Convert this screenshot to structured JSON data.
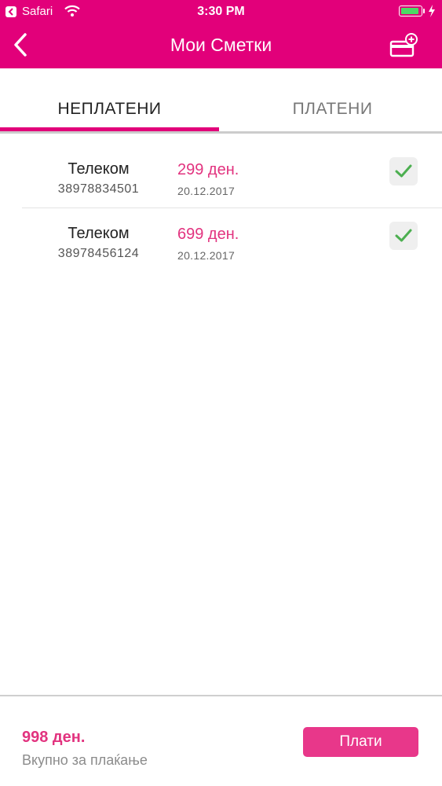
{
  "status_bar": {
    "app": "Safari",
    "time": "3:30 PM",
    "battery_percent": 95
  },
  "nav": {
    "title": "Мои Сметки",
    "icons": {
      "back": "chevron-left-icon",
      "add_card": "add-card-icon"
    }
  },
  "tabs": [
    {
      "label": "НЕПЛАТЕНИ",
      "active": true
    },
    {
      "label": "ПЛАТЕНИ",
      "active": false
    }
  ],
  "bills": [
    {
      "company": "Телеком",
      "number": "38978834501",
      "amount": "299 ден.",
      "date": "20.12.2017",
      "checked": true
    },
    {
      "company": "Телеком",
      "number": "38978456124",
      "amount": "699 ден.",
      "date": "20.12.2017",
      "checked": true
    }
  ],
  "footer": {
    "total": "998 ден.",
    "total_label": "Вкупно за плаќање",
    "pay_label": "Плати"
  },
  "colors": {
    "brand": "#e2007a",
    "amount": "#e2337f",
    "check": "#4caf50"
  }
}
